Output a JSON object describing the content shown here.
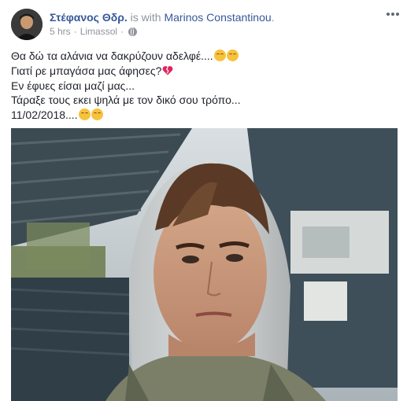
{
  "post": {
    "author": "Στέφανος Θδρ.",
    "with_text": " is with ",
    "tagged": "Marinos Constantinou",
    "tagged_suffix": ".",
    "time": "5 hrs",
    "separator": "·",
    "location": "Limassol",
    "separator2": "·",
    "privacy_icon": "globe-icon",
    "more_icon": "ellipsis-icon"
  },
  "text_lines": {
    "line1": "Θα δώ τα αλάνια να δακρύζουν αδελφέ....",
    "line2": "Γιατί ρε μπαγάσα μας άφησες?",
    "line3": "Εν έφυες είσαι μαζί μας...",
    "line4": "Τάραξε τους εκει ψηλά με τον δικό σου τρόπο...",
    "line5": "11/02/2018...."
  },
  "emojis": {
    "line1": [
      "pensive-face",
      "pensive-face"
    ],
    "line2": [
      "broken-heart"
    ],
    "line5": [
      "relieved-face",
      "relieved-face"
    ]
  },
  "colors": {
    "link": "#365899",
    "meta": "#90949c",
    "text": "#1d2129"
  }
}
